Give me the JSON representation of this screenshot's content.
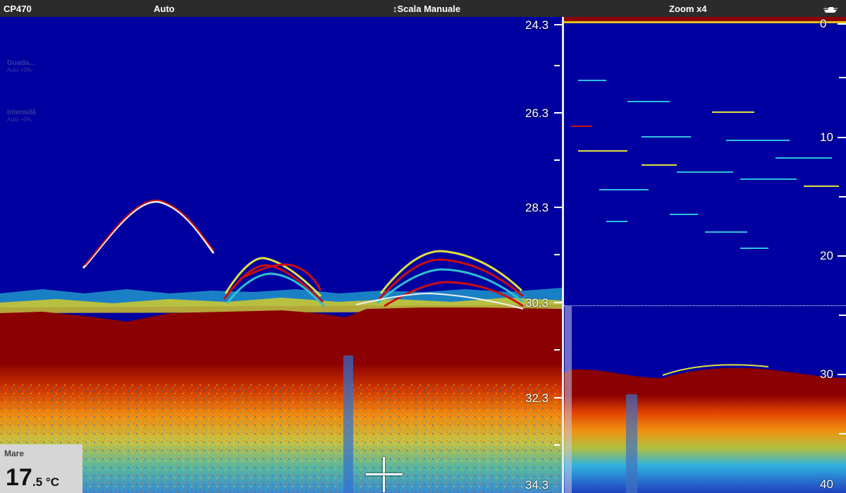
{
  "topbar": {
    "device": "CP470",
    "mode": "Auto",
    "scale": "↕Scala Manuale",
    "zoom": "Zoom x4",
    "boat_icon": "boat-icon"
  },
  "left_panel": {
    "depth_labels": [
      "24.3",
      "26.3",
      "28.3",
      "30.3",
      "32.3",
      "34.3"
    ],
    "gain": {
      "title": "Guada...",
      "value": "Auto +0%"
    },
    "intensity": {
      "title": "Intensità",
      "value": "Auto +0%"
    },
    "temperature": {
      "label": "Mare",
      "integer": "17",
      "decimal": ".5 °C"
    }
  },
  "right_panel": {
    "depth_labels": [
      "0",
      "10",
      "20",
      "30",
      "40"
    ]
  },
  "colors": {
    "water": "#0000a0",
    "bottom": "#8b0000",
    "topbar": "#2b2b2b",
    "scale_text": "#ffffff"
  }
}
